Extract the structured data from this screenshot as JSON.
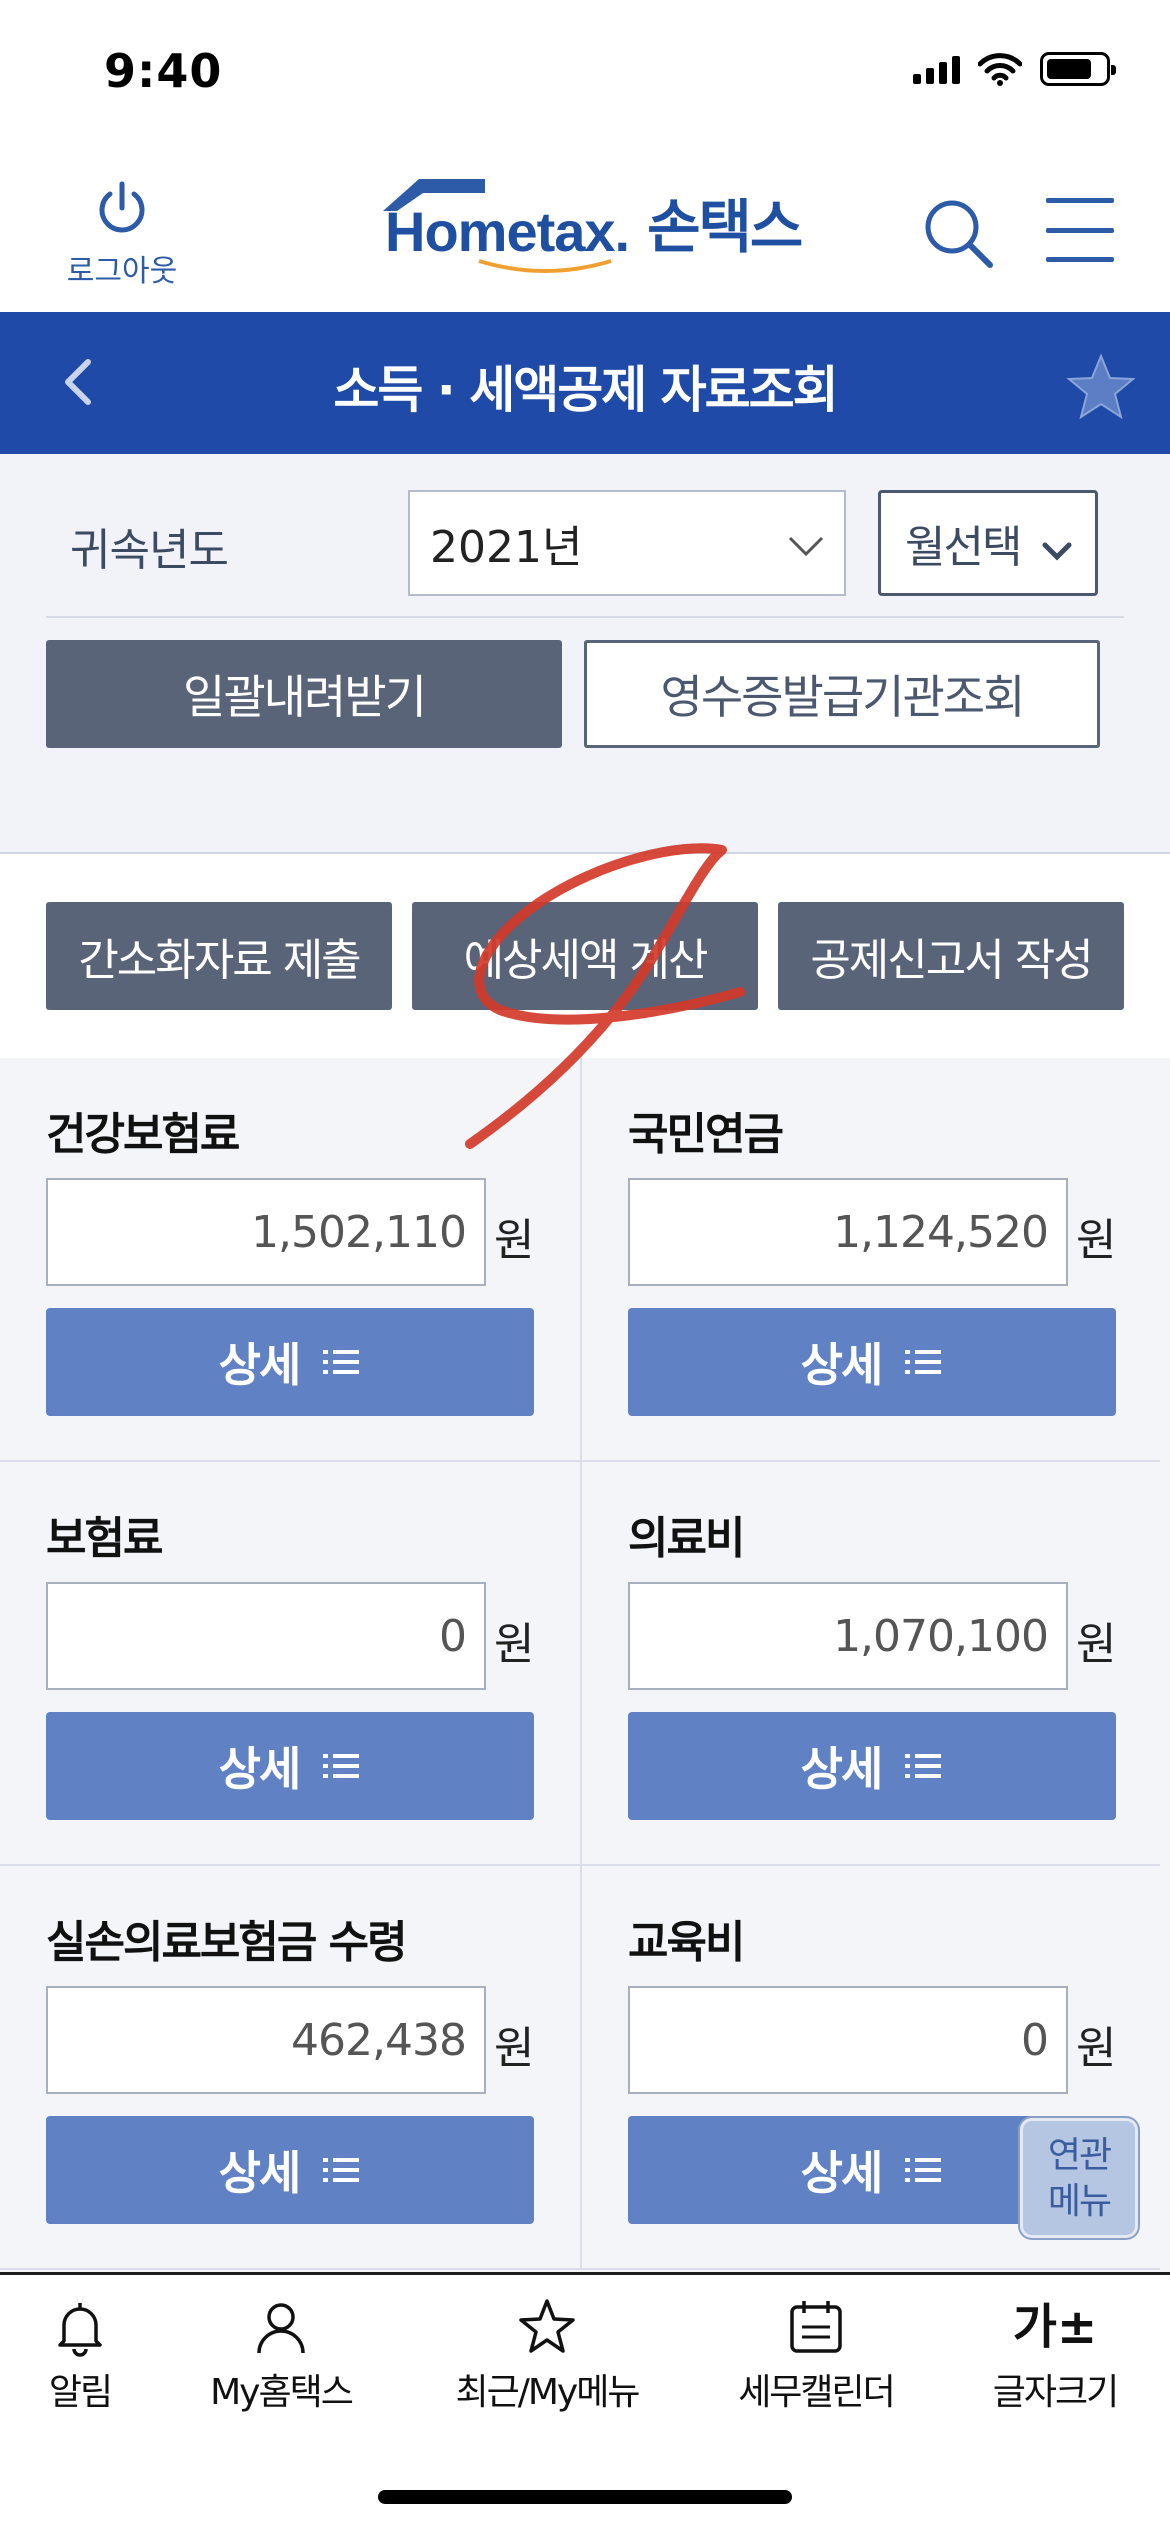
{
  "status_bar": {
    "time": "9:40"
  },
  "header": {
    "logout_label": "로그아웃",
    "logo_en": "Hometax.",
    "logo_ko": "손택스"
  },
  "title_bar": {
    "title": "소득 · 세액공제 자료조회"
  },
  "filter": {
    "year_label": "귀속년도",
    "year_value": "2021년",
    "month_select": "월선택",
    "download_all": "일괄내려받기",
    "receipt_issuer": "영수증발급기관조회"
  },
  "actions": {
    "submit_simplified": "간소화자료 제출",
    "estimate_tax": "예상세액 계산",
    "write_deduction": "공제신고서 작성"
  },
  "items": [
    {
      "title": "건강보험료",
      "amount": "1,502,110",
      "unit": "원",
      "detail": "상세"
    },
    {
      "title": "국민연금",
      "amount": "1,124,520",
      "unit": "원",
      "detail": "상세"
    },
    {
      "title": "보험료",
      "amount": "0",
      "unit": "원",
      "detail": "상세"
    },
    {
      "title": "의료비",
      "amount": "1,070,100",
      "unit": "원",
      "detail": "상세"
    },
    {
      "title": "실손의료보험금 수령",
      "amount": "462,438",
      "unit": "원",
      "detail": "상세"
    },
    {
      "title": "교육비",
      "amount": "0",
      "unit": "원",
      "detail": "상세"
    }
  ],
  "related_menu": {
    "line1": "연관",
    "line2": "메뉴"
  },
  "bottom_nav": [
    {
      "label": "알림",
      "icon": "bell-icon"
    },
    {
      "label": "My홈택스",
      "icon": "person-icon"
    },
    {
      "label": "최근/My메뉴",
      "icon": "star-icon"
    },
    {
      "label": "세무캘린더",
      "icon": "calendar-icon"
    },
    {
      "label": "글자크기",
      "icon": "font-size-icon",
      "glyph": "가±"
    }
  ],
  "colors": {
    "brand_blue": "#1f4aa8",
    "button_gray": "#5a6478",
    "detail_blue": "#6082c4",
    "annotation_red": "#d23a2a"
  }
}
